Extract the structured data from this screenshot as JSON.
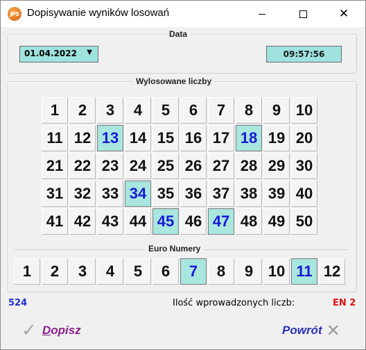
{
  "window": {
    "title": "Dopisywanie wyników losowań",
    "icon_text": "JPS"
  },
  "data_group": {
    "legend": "Data",
    "date_value": "01.04.2022",
    "time_value": "09:57:56"
  },
  "wylosowane": {
    "legend": "Wylosowane liczby",
    "numbers": [
      1,
      2,
      3,
      4,
      5,
      6,
      7,
      8,
      9,
      10,
      11,
      12,
      13,
      14,
      15,
      16,
      17,
      18,
      19,
      20,
      21,
      22,
      23,
      24,
      25,
      26,
      27,
      28,
      29,
      30,
      31,
      32,
      33,
      34,
      35,
      36,
      37,
      38,
      39,
      40,
      41,
      42,
      43,
      44,
      45,
      46,
      47,
      48,
      49,
      50
    ],
    "selected": [
      13,
      18,
      34,
      45,
      47
    ]
  },
  "euro": {
    "legend": "Euro Numery",
    "numbers": [
      1,
      2,
      3,
      4,
      5,
      6,
      7,
      8,
      9,
      10,
      11,
      12
    ],
    "selected": [
      7,
      11
    ]
  },
  "status": {
    "counter": "524",
    "count_label": "Ilość wprowadzonych liczb:",
    "count_value": "EN 2"
  },
  "buttons": {
    "dopisz_first": "D",
    "dopisz_rest": "opisz",
    "powrot": "Powrót"
  },
  "colors": {
    "selected_bg": "#a8e6de",
    "selected_text": "#1919d6",
    "accent_red": "#e01010",
    "dopisz_text": "#8a1f8c",
    "powrot_text": "#2b2fb8"
  }
}
